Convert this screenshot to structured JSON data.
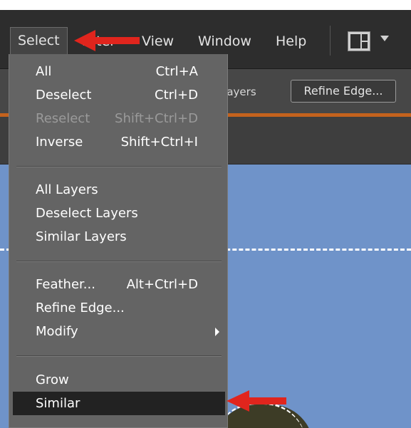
{
  "menubar": {
    "items": [
      {
        "label": "Select"
      },
      {
        "label": "Filter"
      },
      {
        "label": "View"
      },
      {
        "label": "Window"
      },
      {
        "label": "Help"
      }
    ]
  },
  "options": {
    "layers_label": "Layers",
    "refine_button": "Refine Edge..."
  },
  "select_menu": {
    "items": [
      {
        "label": "All",
        "shortcut": "Ctrl+A"
      },
      {
        "label": "Deselect",
        "shortcut": "Ctrl+D"
      },
      {
        "label": "Reselect",
        "shortcut": "Shift+Ctrl+D"
      },
      {
        "label": "Inverse",
        "shortcut": "Shift+Ctrl+I"
      },
      {
        "label": "All Layers"
      },
      {
        "label": "Deselect Layers"
      },
      {
        "label": "Similar Layers"
      },
      {
        "label": "Feather...",
        "shortcut": "Alt+Ctrl+D"
      },
      {
        "label": "Refine Edge..."
      },
      {
        "label": "Modify"
      },
      {
        "label": "Grow"
      },
      {
        "label": "Similar"
      }
    ]
  },
  "colors": {
    "accent_orange": "#c4621d",
    "arrow_red": "#e0251d",
    "highlight": "#222222"
  }
}
